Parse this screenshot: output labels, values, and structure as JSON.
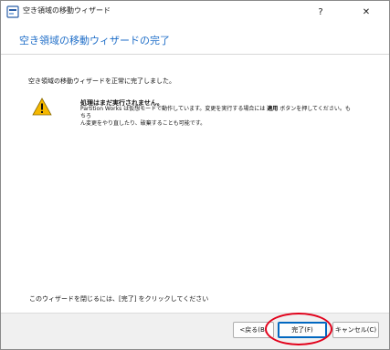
{
  "window": {
    "title": "空き領域の移動ウィザード",
    "help_label": "?",
    "close_label": "✕"
  },
  "header": {
    "title": "空き領域の移動ウィザードの完了"
  },
  "content": {
    "message": "空き領域の移動ウィザードを正常に完了しました。",
    "warning": {
      "title": "処理はまだ実行されません。",
      "line1_pre": "Partition Works は仮想モードで動作しています。変更を実行する場合には ",
      "line1_bold": "適用",
      "line1_post": " ボタンを押してください。もちろ",
      "line2": "ん変更をやり直したり、破棄することも可能です。"
    },
    "close_hint": "このウィザードを閉じるには、[完了] をクリックしてください"
  },
  "footer": {
    "back_label": "<戻る(B)",
    "finish_label": "完了(F)",
    "cancel_label": "キャンセル(C)"
  },
  "colors": {
    "accent": "#1f6ec8",
    "annotation": "#e2001a",
    "warning": "#f5b800"
  }
}
